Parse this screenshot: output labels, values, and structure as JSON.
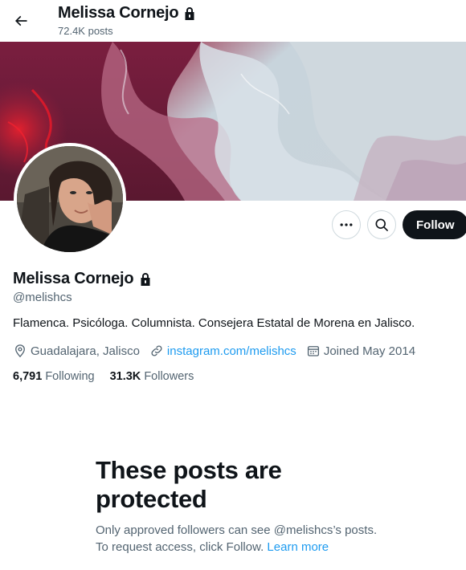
{
  "header": {
    "name": "Melissa Cornejo",
    "posts_count": "72.4K posts"
  },
  "actions": {
    "follow_label": "Follow"
  },
  "profile": {
    "name": "Melissa Cornejo",
    "handle": "@melishcs",
    "bio": "Flamenca. Psicóloga. Columnista. Consejera Estatal de Morena en Jalisco.",
    "location": "Guadalajara, Jalisco",
    "website": "instagram.com/melishcs",
    "joined": "Joined May 2014",
    "following_count": "6,791",
    "following_label": "Following",
    "followers_count": "31.3K",
    "followers_label": "Followers"
  },
  "protected": {
    "title": "These posts are protected",
    "desc_line1": "Only approved followers can see @melishcs’s posts.",
    "desc_line2": "To request access, click Follow. ",
    "learn_more": "Learn more"
  },
  "icons": [
    "back-arrow-icon",
    "lock-icon",
    "more-icon",
    "search-icon",
    "location-pin-icon",
    "link-icon",
    "calendar-icon"
  ],
  "colors": {
    "text_primary": "#0f1419",
    "text_secondary": "#536471",
    "accent": "#1d9bf0",
    "follow_button_bg": "#0f1419"
  }
}
